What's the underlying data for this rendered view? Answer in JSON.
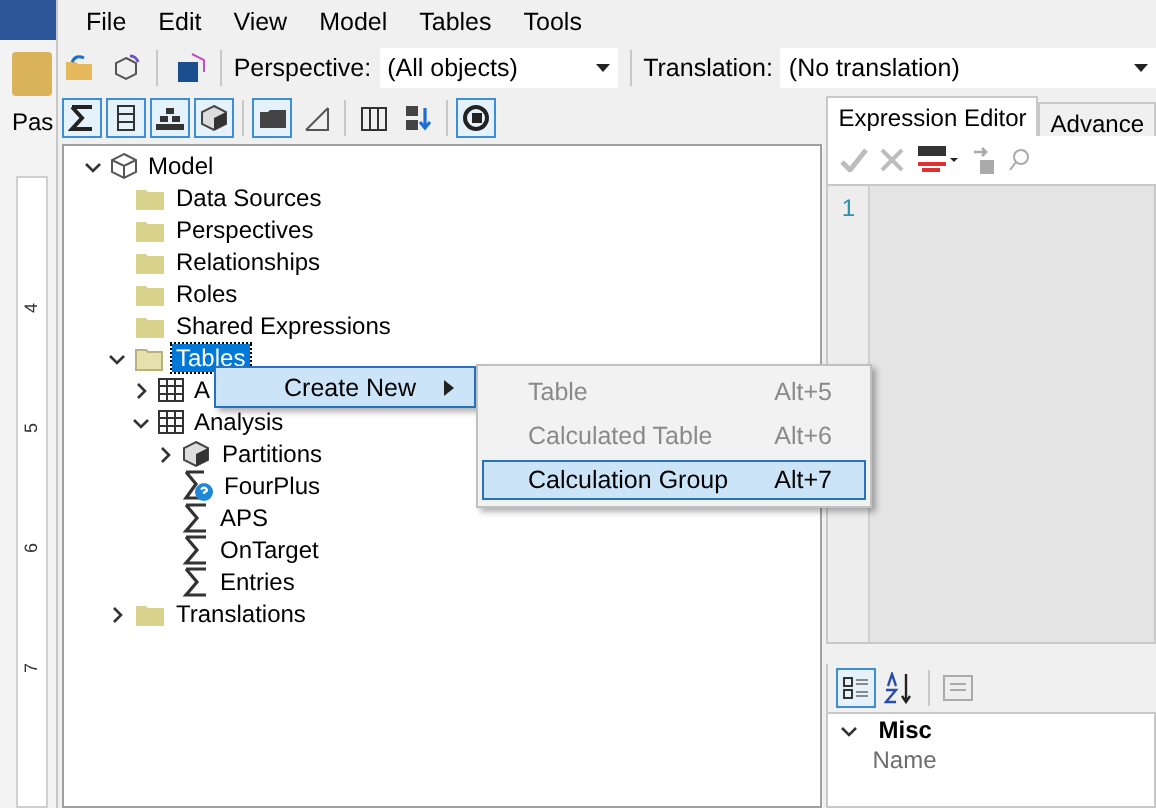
{
  "left_strip": {
    "paste_label": "Pas",
    "ruler_numbers": [
      "4",
      "5",
      "6",
      "7"
    ]
  },
  "menu_bar": [
    "File",
    "Edit",
    "View",
    "Model",
    "Tables",
    "Tools"
  ],
  "toolbar": {
    "perspective_label": "Perspective:",
    "perspective_value": "(All objects)",
    "translation_label": "Translation:",
    "translation_value": "(No translation)"
  },
  "view_buttons": [
    {
      "kind": "sigma",
      "selected": true
    },
    {
      "kind": "column",
      "selected": true
    },
    {
      "kind": "hierarchy",
      "selected": true
    },
    {
      "kind": "cube",
      "selected": true
    },
    {
      "kind": "folder",
      "selected": true
    },
    {
      "kind": "diagonal",
      "selected": false
    },
    {
      "kind": "columns",
      "selected": false
    },
    {
      "kind": "sort",
      "selected": false
    },
    {
      "kind": "circle",
      "selected": true
    }
  ],
  "tree": [
    {
      "label": "Model",
      "kind": "model",
      "expanded": true,
      "selected": false,
      "children": [
        {
          "label": "Data Sources",
          "kind": "folder",
          "selected": false
        },
        {
          "label": "Perspectives",
          "kind": "folder",
          "selected": false
        },
        {
          "label": "Relationships",
          "kind": "folder",
          "selected": false
        },
        {
          "label": "Roles",
          "kind": "folder",
          "selected": false
        },
        {
          "label": "Shared Expressions",
          "kind": "folder",
          "selected": false
        },
        {
          "label": "Tables",
          "kind": "openfolder",
          "expanded": true,
          "selected": true,
          "children": [
            {
              "label": "A",
              "kind": "table",
              "expanded": false,
              "selected": false
            },
            {
              "label": "Analysis",
              "kind": "table",
              "expanded": true,
              "selected": false,
              "children": [
                {
                  "label": "Partitions",
                  "kind": "partitions",
                  "expanded": false,
                  "selected": false
                },
                {
                  "label": "FourPlus",
                  "kind": "measure_warning",
                  "selected": false
                },
                {
                  "label": "APS",
                  "kind": "measure",
                  "selected": false
                },
                {
                  "label": "OnTarget",
                  "kind": "measure",
                  "selected": false
                },
                {
                  "label": "Entries",
                  "kind": "measure",
                  "selected": false
                }
              ]
            }
          ]
        },
        {
          "label": "Translations",
          "kind": "folder",
          "expanded": false,
          "selected": false
        }
      ]
    }
  ],
  "context_menu": {
    "items": [
      {
        "label": "Create New",
        "selected": true
      }
    ],
    "submenu": [
      {
        "label": "Table",
        "shortcut": "Alt+5",
        "disabled": true,
        "selected": false
      },
      {
        "label": "Calculated Table",
        "shortcut": "Alt+6",
        "disabled": true,
        "selected": false
      },
      {
        "label": "Calculation Group",
        "shortcut": "Alt+7",
        "disabled": false,
        "selected": true
      }
    ]
  },
  "expression_editor": {
    "tabs": [
      {
        "label": "Expression Editor",
        "selected": true
      },
      {
        "label": "Advance",
        "selected": false
      }
    ],
    "line_numbers": [
      "1"
    ]
  },
  "properties": {
    "groups": [
      {
        "label": "Misc",
        "expanded": true,
        "rows": [
          {
            "name": "Name"
          }
        ]
      }
    ]
  }
}
